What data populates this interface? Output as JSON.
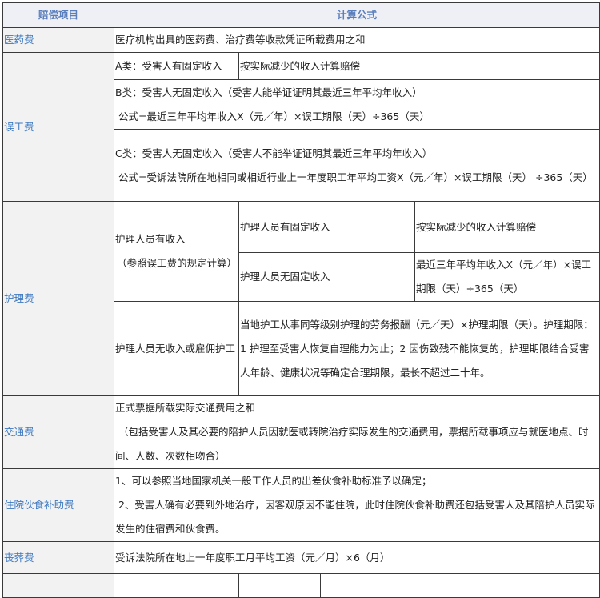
{
  "header": {
    "item": "赔偿项目",
    "formula": "计算公式"
  },
  "medical": {
    "label": "医药费",
    "formula": "医疗机构出具的医药费、治疗费等收款凭证所载费用之和"
  },
  "lost_wages": {
    "label": "误工费",
    "a_label": "A类：受害人有固定收入",
    "a_formula": "按实际减少的收入计算赔偿",
    "b_line1": "B类：受害人无固定收入（受害人能举证证明其最近三年平均年收入）",
    "b_line2": " 公式=最近三年平均年收入X（元／年）×误工期限（天）÷365（天）",
    "c_line1": "C类：受害人无固定收入（受害人不能举证证明其最近三年平均年收入）",
    "c_line2": " 公式=受诉法院所在地相同或相近行业上一年度职工年平均工资X（元／年）×误工期限（天） ÷365（天）"
  },
  "nursing": {
    "label": "护理费",
    "with_income": "护理人员有收入",
    "with_income_note": "（参照误工费的规定计算）",
    "fixed_income": "护理人员有固定收入",
    "fixed_formula": "按实际减少的收入计算赔偿",
    "no_fixed_income": "护理人员无固定收入",
    "no_fixed_formula": "最近三年平均年收入X（元／年）×误工期限（天）÷365（天）",
    "no_income": "护理人员无收入或雇佣护工",
    "no_income_formula": "当地护工从事同等级别护理的劳务报酬（元／天）×护理期限（天）。护理期限：1 护理至受害人恢复自理能力为止；2 因伤致残不能恢复的，护理期限结合受害人年龄、健康状况等确定合理期限，最长不超过二十年。"
  },
  "transport": {
    "label": "交通费",
    "line1": "正式票据所载实际交通费用之和",
    "line2": " （包括受害人及其必要的陪护人员因就医或转院治疗实际发生的交通费用，票据所载事项应与就医地点、时间、人数、次数相吻合）"
  },
  "meal": {
    "label": "住院伙食补助费",
    "line1": "1、可以参照当地国家机关一般工作人员的出差伙食补助标准予以确定；",
    "line2": " 2、受害人确有必要到外地治疗，因客观原因不能住院，此时住院伙食补助费还包括受害人及其陪护人员实际发生的住宿费和伙食费。"
  },
  "funeral": {
    "label": "丧葬费",
    "formula": "受诉法院所在地上一年度职工月平均工资（元／月）×6（月）"
  }
}
